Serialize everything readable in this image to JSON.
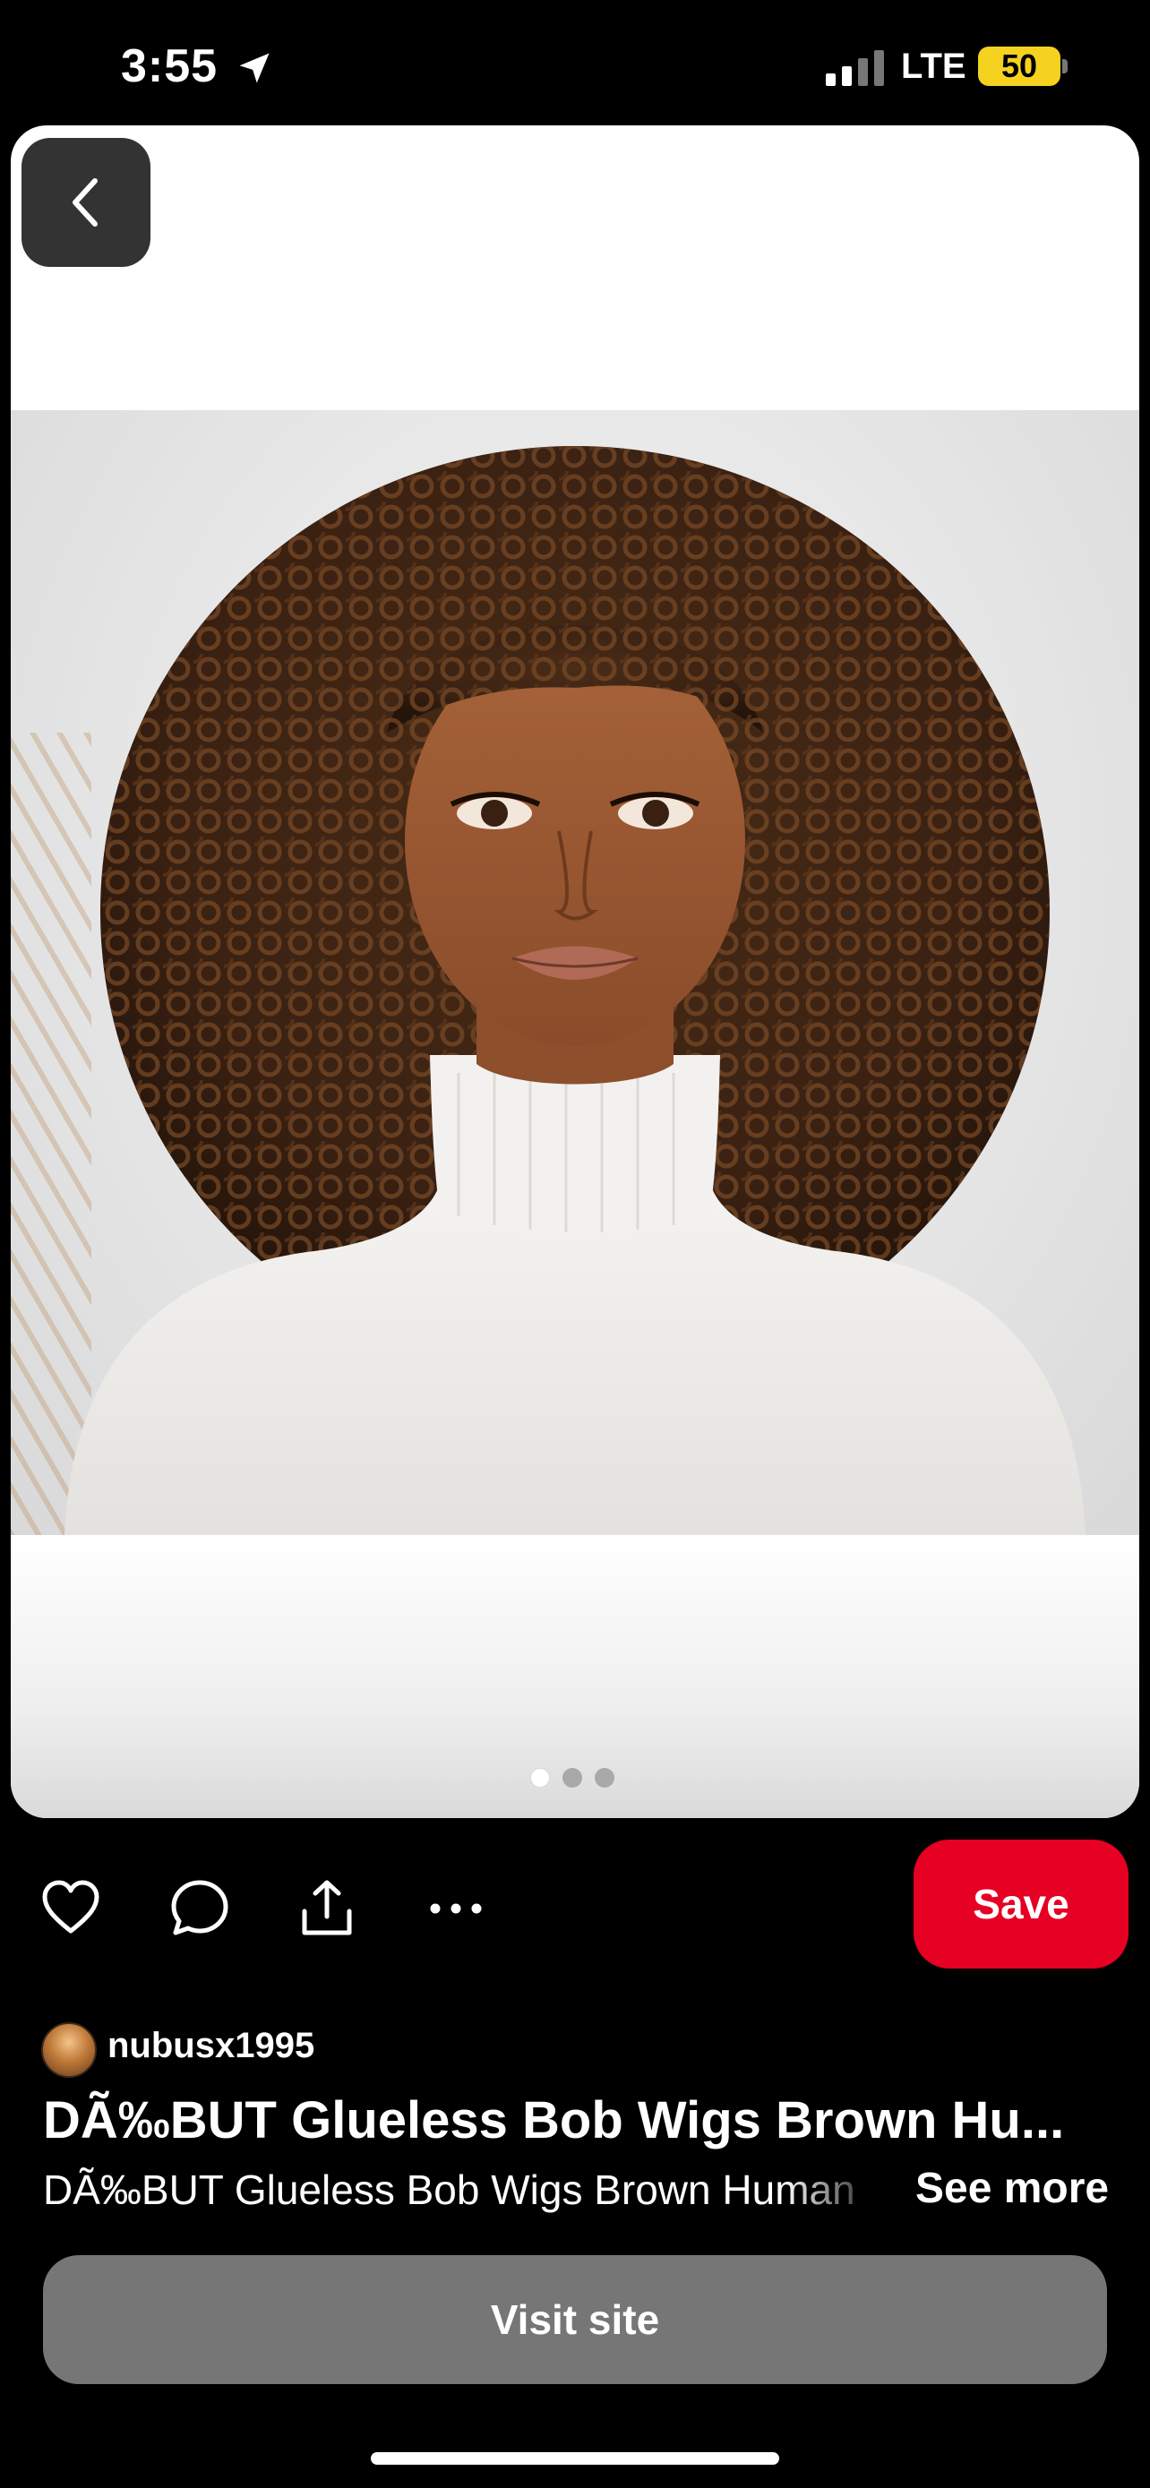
{
  "status_bar": {
    "time": "3:55",
    "network": "LTE",
    "battery": "50",
    "icons": [
      "location-arrow-icon",
      "signal-icon",
      "battery-icon"
    ],
    "battery_color": "#f5d21f"
  },
  "pin": {
    "back_icon": "chevron-left-icon",
    "carousel": {
      "count": 3,
      "active_index": 0
    }
  },
  "actions": {
    "icons": [
      "heart-icon",
      "comment-icon",
      "share-icon",
      "more-icon"
    ],
    "save_label": "Save",
    "save_color": "#e60023"
  },
  "creator": {
    "username": "nubusx1995"
  },
  "content": {
    "title": "DÃ‰BUT Glueless Bob Wigs Brown Hu...",
    "description": "DÃ‰BUT Glueless Bob Wigs Brown Human",
    "see_more": "See more"
  },
  "visit": {
    "label": "Visit site"
  }
}
